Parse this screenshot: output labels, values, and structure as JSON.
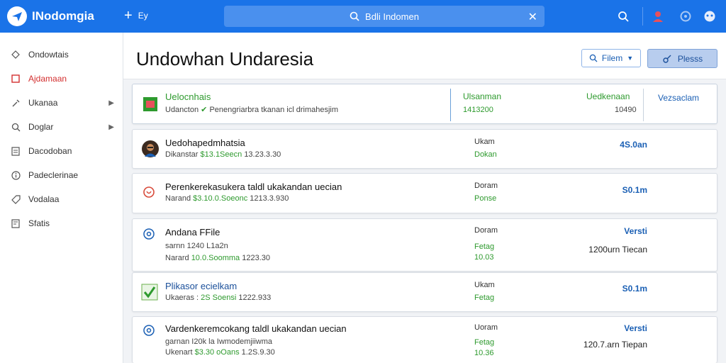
{
  "app": {
    "title": "INodomgia",
    "new_label": "Ey",
    "search_text": "Bdli Indomen"
  },
  "sidebar": {
    "items": [
      {
        "label": "Ondowtais",
        "icon": "diamond-icon",
        "active": false,
        "chevron": false
      },
      {
        "label": "Ajdamaan",
        "icon": "square-icon",
        "active": true,
        "chevron": false
      },
      {
        "label": "Ukanaa",
        "icon": "tool-icon",
        "active": false,
        "chevron": true
      },
      {
        "label": "Doglar",
        "icon": "search-icon",
        "active": false,
        "chevron": true
      },
      {
        "label": "Dacodoban",
        "icon": "document-icon",
        "active": false,
        "chevron": false
      },
      {
        "label": "Padeclerinae",
        "icon": "info-icon",
        "active": false,
        "chevron": false
      },
      {
        "label": "Vodalaa",
        "icon": "tag-icon",
        "active": false,
        "chevron": false
      },
      {
        "label": "Sfatis",
        "icon": "file-icon",
        "active": false,
        "chevron": false
      }
    ]
  },
  "header": {
    "title": "Undowhan Undaresia",
    "filter_label": "Filem",
    "primary_label": "Plesss"
  },
  "top_card": {
    "title": "Uelocnhais",
    "subtitle_prefix": "Udancton",
    "subtitle_rest": "Penengriarbra tkanan icl drimahesjim",
    "col1_label": "Ulsanman",
    "col1_value": "1413200",
    "col2_label": "Uedkenaan",
    "col2_value": "10490",
    "col3_label": "Vezsaclam"
  },
  "rows": [
    {
      "title": "Uedohapedmhatsia",
      "sub_label": "Dikanstar",
      "sub_green": "$13.1Seecn",
      "sub_date": "13.23.3.30",
      "col1a": "Ukam",
      "col1b": "Dokan",
      "amount": "4S.0an",
      "time": "",
      "icon": "avatar"
    },
    {
      "title": "Perenkerekasukera taldl ukakandan uecian",
      "sub_label": "Narand",
      "sub_green": "$3.10.0.Soeonc",
      "sub_date": "1213.3.930",
      "col1a": "Doram",
      "col1b": "Ponse",
      "amount": "S0.1m",
      "time": "",
      "icon": "ring-icon"
    },
    {
      "title": "Andana FFile",
      "sub_label": "Narard",
      "sub_green": "10.0.Soomma",
      "sub_date": "1223.30",
      "sub_extra": "sarnn 1240 L1a2n",
      "col1a": "Doram",
      "col1b": "Fetag",
      "col1c": "10.03",
      "amount": "Versti",
      "time": "1200urn Tiecan",
      "icon": "target-icon"
    },
    {
      "title": "Plikasor ecielkam",
      "sub_label": "Ukaeras :",
      "sub_green": "2S Soensi",
      "sub_date": "1222.933",
      "col1a": "Ukam",
      "col1b": "Fetag",
      "amount": "S0.1m",
      "time": "",
      "icon": "check-icon"
    },
    {
      "title": "Vardenkeremcokang taldl ukakandan uecian",
      "sub_label": "Ukenart",
      "sub_green": "$3.30 oOans",
      "sub_date": "1.2S.9.30",
      "sub_extra": "garnan I20k la Iwmodemjiiwma",
      "col1a": "Uoram",
      "col1b": "Fetag",
      "col1c": "10.36",
      "amount": "Versti",
      "time": "120.7.arn Tiepan",
      "icon": "target-icon"
    }
  ]
}
